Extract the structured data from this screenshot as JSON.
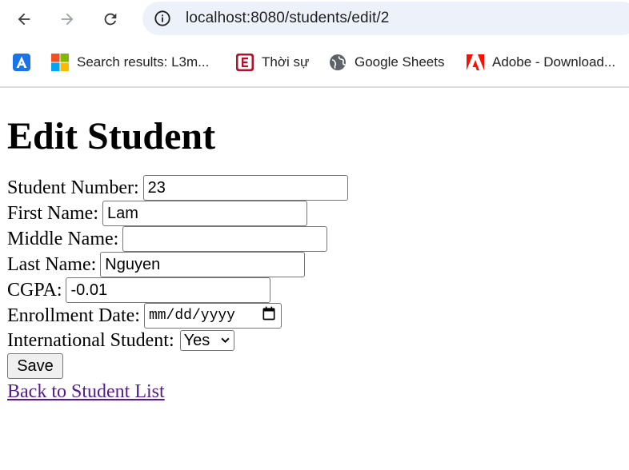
{
  "browser": {
    "url": "localhost:8080/students/edit/2",
    "bookmarks": [
      {
        "label": "",
        "icon": "app-launcher-icon"
      },
      {
        "label": "Search results: L3m...",
        "icon": "microsoft-logo-icon"
      },
      {
        "label": "Thời sự",
        "icon": "e-news-icon"
      },
      {
        "label": "Google Sheets",
        "icon": "globe-icon"
      },
      {
        "label": "Adobe - Download...",
        "icon": "adobe-logo-icon"
      }
    ]
  },
  "page": {
    "title": "Edit Student",
    "fields": {
      "student_number": {
        "label": "Student Number:",
        "value": "23"
      },
      "first_name": {
        "label": "First Name:",
        "value": "Lam"
      },
      "middle_name": {
        "label": "Middle Name:",
        "value": ""
      },
      "last_name": {
        "label": "Last Name:",
        "value": "Nguyen"
      },
      "cgpa": {
        "label": "CGPA:",
        "value": "-0.01"
      },
      "enrollment_date": {
        "label": "Enrollment Date:",
        "placeholder": "mm/dd/yyyy"
      },
      "international": {
        "label": "International Student:",
        "value": "Yes"
      }
    },
    "save_label": "Save",
    "back_link": "Back to Student List"
  },
  "colors": {
    "omnibox_bg": "#edf2fa",
    "link_visited": "#551a8b",
    "button_bg": "#efefef"
  }
}
